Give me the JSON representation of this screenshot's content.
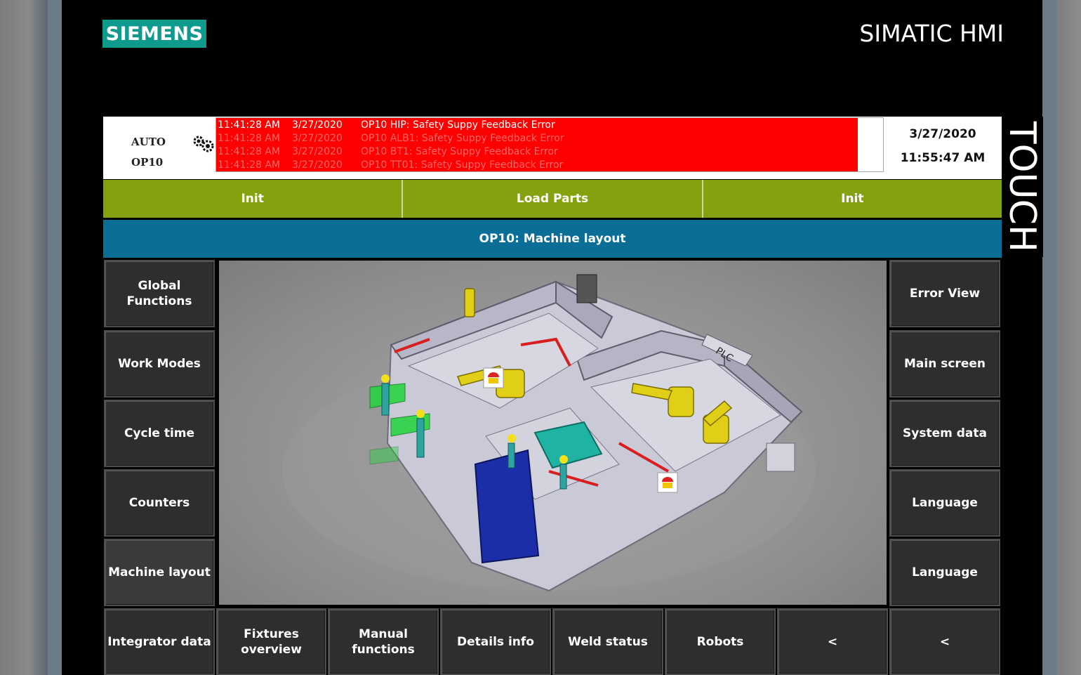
{
  "brand": {
    "logo": "SIEMENS",
    "product": "SIMATIC HMI",
    "touch": "TOUCH"
  },
  "status": {
    "mode": "AUTO",
    "station": "OP10",
    "alarms": [
      {
        "time": "11:41:28 AM",
        "date": "3/27/2020",
        "text": "OP10 HIP: Safety Suppy Feedback Error"
      },
      {
        "time": "11:41:28 AM",
        "date": "3/27/2020",
        "text": "OP10 ALB1: Safety Suppy Feedback Error"
      },
      {
        "time": "11:41:28 AM",
        "date": "3/27/2020",
        "text": "OP10 BT1: Safety Suppy Feedback Error"
      },
      {
        "time": "11:41:28 AM",
        "date": "3/27/2020",
        "text": "OP10 TT01: Safety Suppy Feedback Error"
      }
    ],
    "date": "3/27/2020",
    "time": "11:55:47 AM"
  },
  "actions": [
    "Init",
    "Load Parts",
    "Init"
  ],
  "screen_title": "OP10: Machine layout",
  "left_nav": [
    "Global Functions",
    "Work Modes",
    "Cycle time",
    "Counters",
    "Machine layout"
  ],
  "right_nav": [
    "Error View",
    "Main screen",
    "System data",
    "Language",
    "Language"
  ],
  "bottom_nav": [
    "Integrator data",
    "Fixtures overview",
    "Manual functions",
    "Details info",
    "Weld status",
    "Robots",
    "<",
    "<"
  ],
  "layout_labels": {
    "plc": "PLC"
  },
  "colors": {
    "alarm": "#fe0000",
    "action_bar": "#84a20d",
    "title_bar": "#0a6e96",
    "logo": "#0f9a8e",
    "button": "#2e2e2e"
  }
}
